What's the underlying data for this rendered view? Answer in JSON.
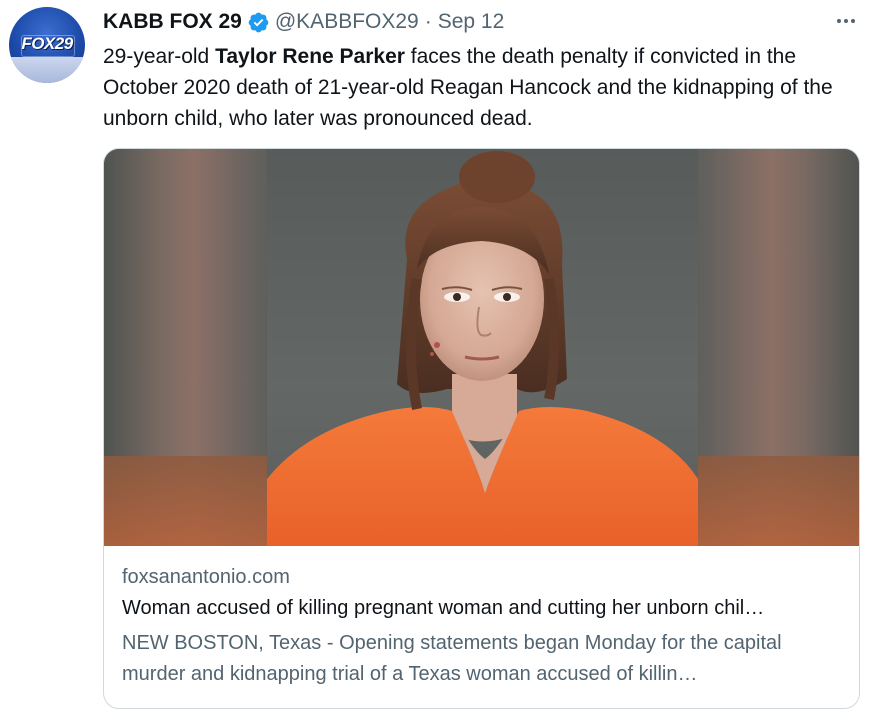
{
  "author": {
    "display_name": "KABB FOX 29",
    "handle": "@KABBFOX29",
    "separator": "·",
    "date": "Sep 12",
    "avatar_text": "FOX29"
  },
  "tweet": {
    "text_before": "29-year-old ",
    "text_bold": "Taylor Rene Parker",
    "text_after": " faces the death penalty if convicted in the October 2020 death of 21-year-old Reagan Hancock and the kidnapping of the unborn child, who later was pronounced dead."
  },
  "card": {
    "domain": "foxsanantonio.com",
    "title": "Woman accused of killing pregnant woman and cutting her unborn chil…",
    "description": "NEW BOSTON, Texas - Opening statements began Monday for the capital murder and kidnapping trial of a Texas woman accused of killin…"
  },
  "icons": {
    "verified": "verified-badge-icon",
    "more": "more-options-icon"
  },
  "colors": {
    "verified_blue": "#1d9bf0",
    "secondary_text": "#536471",
    "primary_text": "#0f1419",
    "card_border": "#cfd9de",
    "jumpsuit_orange": "#f26a2a"
  }
}
